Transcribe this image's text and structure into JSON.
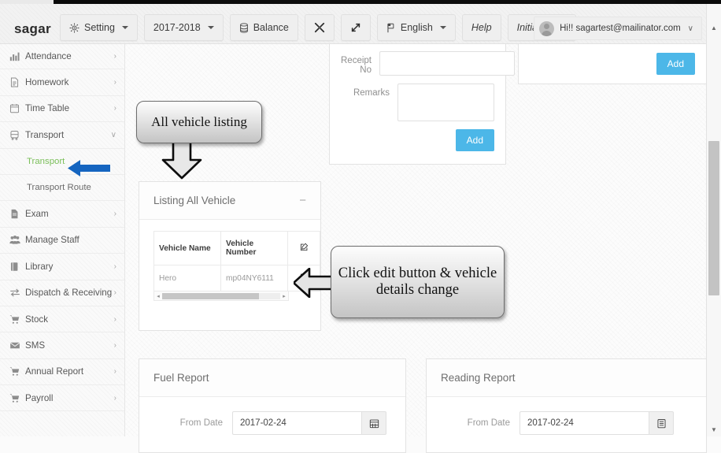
{
  "header": {
    "brand": "sagar",
    "buttons": [
      {
        "label": "Setting",
        "icon": "gear-icon",
        "caret": true
      },
      {
        "label": "2017-2018",
        "icon": "",
        "caret": true
      },
      {
        "label": "Balance",
        "icon": "database-icon",
        "caret": false
      },
      {
        "label": "",
        "icon": "compress-icon",
        "caret": false
      },
      {
        "label": "",
        "icon": "expand-icon",
        "caret": false
      },
      {
        "label": "English",
        "icon": "flag-icon",
        "caret": true
      },
      {
        "label": "Help",
        "icon": "",
        "caret": false
      },
      {
        "label": "Initial setup",
        "icon": "",
        "caret": false
      }
    ],
    "user": {
      "greeting": "Hi!! sagartest@mailinator.com",
      "chevron": "∨"
    }
  },
  "sidebar": {
    "items": [
      {
        "label": "Attendance",
        "icon": "bar-chart-icon",
        "arrow": "›",
        "sub": false,
        "active": false
      },
      {
        "label": "Homework",
        "icon": "file-text-icon",
        "arrow": "›",
        "sub": false,
        "active": false
      },
      {
        "label": "Time Table",
        "icon": "calendar-icon",
        "arrow": "›",
        "sub": false,
        "active": false
      },
      {
        "label": "Transport",
        "icon": "bus-icon",
        "arrow": "∨",
        "sub": false,
        "active": false
      },
      {
        "label": "Transport",
        "icon": "",
        "arrow": "",
        "sub": true,
        "active": true
      },
      {
        "label": "Transport Route",
        "icon": "",
        "arrow": "",
        "sub": true,
        "active": false
      },
      {
        "label": "Exam",
        "icon": "document-icon",
        "arrow": "›",
        "sub": false,
        "active": false
      },
      {
        "label": "Manage Staff",
        "icon": "users-icon",
        "arrow": "",
        "sub": false,
        "active": false
      },
      {
        "label": "Library",
        "icon": "book-icon",
        "arrow": "›",
        "sub": false,
        "active": false
      },
      {
        "label": "Dispatch & Receiving",
        "icon": "exchange-icon",
        "arrow": "›",
        "sub": false,
        "active": false
      },
      {
        "label": "Stock",
        "icon": "cart-icon",
        "arrow": "›",
        "sub": false,
        "active": false
      },
      {
        "label": "SMS",
        "icon": "envelope-icon",
        "arrow": "›",
        "sub": false,
        "active": false
      },
      {
        "label": "Annual Report",
        "icon": "cart-icon",
        "arrow": "›",
        "sub": false,
        "active": false
      },
      {
        "label": "Payroll",
        "icon": "cart-icon",
        "arrow": "›",
        "sub": false,
        "active": false
      }
    ]
  },
  "form_panel": {
    "receipt_label": "Receipt No",
    "receipt_value": "",
    "receipt_placeholder": "",
    "remarks_label": "Remarks",
    "remarks_value": "",
    "remarks_placeholder": "",
    "add_label": "Add"
  },
  "right_panel": {
    "add_label": "Add"
  },
  "listing_panel": {
    "title": "Listing All Vehicle",
    "minimize": "−",
    "columns": [
      "Vehicle Name",
      "Vehicle Number",
      "edit-icon"
    ],
    "rows": [
      {
        "vehicle_name": "Hero",
        "vehicle_number": "mp04NY6111",
        "action": "edit-icon"
      }
    ],
    "scroll_left": "◂",
    "scroll_right": "▸"
  },
  "fuel_panel": {
    "title": "Fuel Report",
    "from_label": "From Date",
    "from_value": "2017-02-24",
    "calendar_icon": "calendar-icon"
  },
  "reading_panel": {
    "title": "Reading Report",
    "from_label": "From Date",
    "from_value": "2017-02-24",
    "calendar_icon": "list-icon"
  },
  "callouts": {
    "listing": "All  vehicle listing",
    "edit": "Click edit button & vehicle details change"
  },
  "colors": {
    "accent_blue": "#4cb7e8",
    "arrow_blue": "#1565c0",
    "active_green": "#7bbf5a",
    "callout_border": "#6d6d6d"
  },
  "scrollbar": {
    "up": "▲",
    "down": "▼"
  }
}
